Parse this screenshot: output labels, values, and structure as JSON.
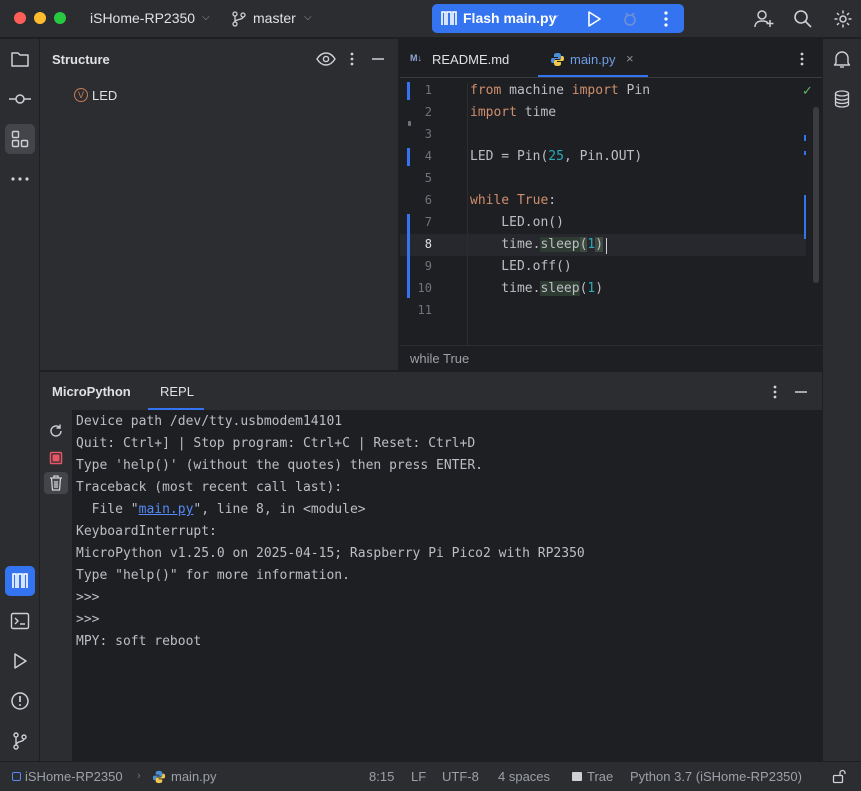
{
  "titlebar": {
    "project": "iSHome-RP2350",
    "branch": "master",
    "flash_label": "Flash main.py"
  },
  "structure": {
    "title": "Structure",
    "item": "LED",
    "item_badge": "V"
  },
  "editor": {
    "tabs": [
      {
        "label": "README.md",
        "icon": "M↓"
      },
      {
        "label": "main.py",
        "active": true
      }
    ],
    "line_numbers": [
      "1",
      "2",
      "3",
      "4",
      "5",
      "6",
      "7",
      "8",
      "9",
      "10",
      "11"
    ],
    "current_line": "8",
    "breadcrumb": "while True"
  },
  "code": {
    "l1": {
      "kw1": "from",
      "t1": " machine ",
      "kw2": "import",
      "t2": " Pin"
    },
    "l2": {
      "kw1": "import",
      "t1": " time"
    },
    "l4": {
      "t1": "LED = Pin(",
      "n1": "25",
      "t2": ", Pin.OUT)"
    },
    "l6": {
      "kw1": "while",
      "t1": " ",
      "kw2": "True",
      "t2": ":"
    },
    "l7": {
      "t1": "    LED.on()"
    },
    "l8": {
      "t1": "    time.",
      "fn": "sleep",
      "p1": "(",
      "n1": "1",
      "p2": ")"
    },
    "l9": {
      "t1": "    LED.off()"
    },
    "l10": {
      "t1": "    time.",
      "fn": "sleep",
      "p1": "(",
      "n1": "1",
      "p2": ")"
    }
  },
  "repl": {
    "tab_micropython": "MicroPython",
    "tab_repl": "REPL",
    "lines": [
      "Device path /dev/tty.usbmodem14101",
      "Quit: Ctrl+] | Stop program: Ctrl+C | Reset: Ctrl+D",
      "Type 'help()' (without the quotes) then press ENTER.",
      "Traceback (most recent call last):"
    ],
    "file_line": {
      "prefix": "  File \"",
      "link": "main.py",
      "suffix": "\", line 8, in <module>"
    },
    "lines2": [
      "KeyboardInterrupt:",
      "MicroPython v1.25.0 on 2025-04-15; Raspberry Pi Pico2 with RP2350",
      "Type \"help()\" for more information.",
      ">>>",
      ">>>",
      "MPY: soft reboot"
    ]
  },
  "status": {
    "project": "iSHome-RP2350",
    "file": "main.py",
    "position": "8:15",
    "line_sep": "LF",
    "encoding": "UTF-8",
    "indent": "4 spaces",
    "trae": "Trae",
    "interpreter": "Python 3.7 (iSHome-RP2350)"
  },
  "colors": {
    "accent": "#3574f0",
    "keyword": "#cf8e6d",
    "number": "#2aacb8",
    "function": "#56a8f5"
  }
}
